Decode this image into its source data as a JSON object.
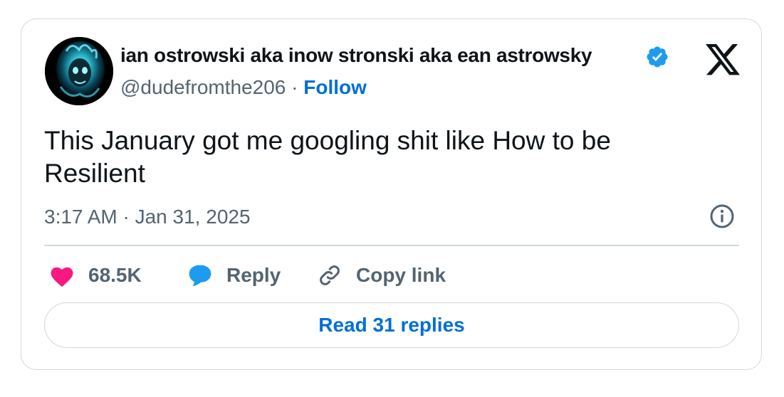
{
  "author": {
    "display_name": "ian ostrowski aka inow stronski aka ean astrowsky",
    "handle": "@dudefromthe206",
    "separator": "·",
    "follow_label": "Follow",
    "verified": true
  },
  "tweet": {
    "text": "This January got me googling shit like How to be Resilient",
    "timestamp": "3:17 AM · Jan 31, 2025"
  },
  "actions": {
    "like_count": "68.5K",
    "reply_label": "Reply",
    "copy_link_label": "Copy link"
  },
  "read_replies_label": "Read 31 replies",
  "colors": {
    "accent_blue": "#006fd6",
    "verified_blue": "#1d9bf0",
    "like_pink": "#f91880",
    "muted_text": "#536471",
    "border": "#cfd9de"
  },
  "icons": [
    "avatar",
    "verified-badge-icon",
    "x-logo-icon",
    "info-icon",
    "heart-icon",
    "reply-bubble-icon",
    "link-icon"
  ]
}
